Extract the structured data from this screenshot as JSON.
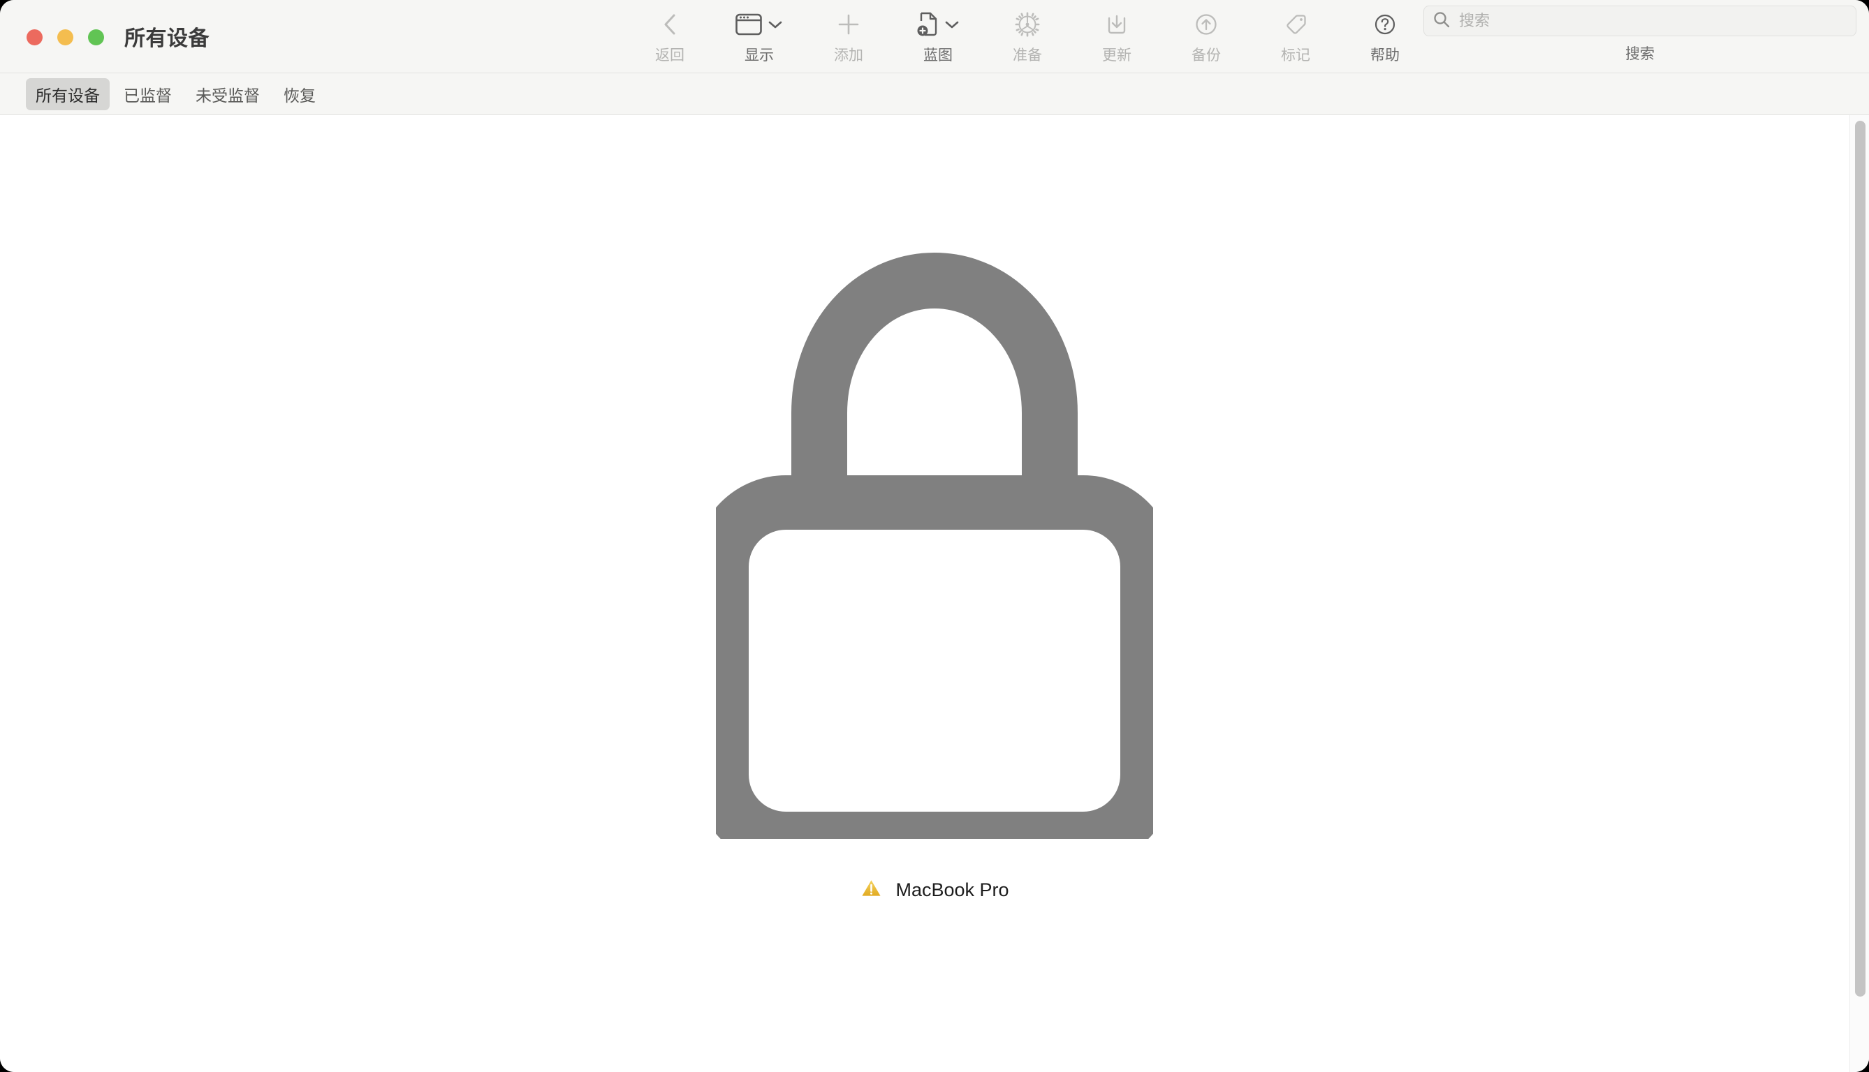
{
  "window": {
    "title": "所有设备",
    "traffic_lights": {
      "close_color": "#ec6a5e",
      "minimize_color": "#f4bd4f",
      "maximize_color": "#61c454"
    }
  },
  "toolbar": {
    "items": [
      {
        "label": "返回",
        "icon": "chevron-left-icon",
        "enabled": false,
        "has_chevron": false
      },
      {
        "label": "显示",
        "icon": "window-icon",
        "enabled": true,
        "has_chevron": true
      },
      {
        "label": "添加",
        "icon": "plus-icon",
        "enabled": false,
        "has_chevron": false
      },
      {
        "label": "蓝图",
        "icon": "blueprint-icon",
        "enabled": true,
        "has_chevron": true
      },
      {
        "label": "准备",
        "icon": "gear-icon",
        "enabled": false,
        "has_chevron": false
      },
      {
        "label": "更新",
        "icon": "download-icon",
        "enabled": false,
        "has_chevron": false
      },
      {
        "label": "备份",
        "icon": "upload-circle-icon",
        "enabled": false,
        "has_chevron": false
      },
      {
        "label": "标记",
        "icon": "tag-icon",
        "enabled": false,
        "has_chevron": false
      },
      {
        "label": "帮助",
        "icon": "question-circle-icon",
        "enabled": true,
        "has_chevron": false
      }
    ]
  },
  "search": {
    "placeholder": "搜索",
    "value": "",
    "caption": "搜索",
    "icon": "search-icon"
  },
  "tabs": [
    {
      "label": "所有设备",
      "selected": true
    },
    {
      "label": "已监督",
      "selected": false
    },
    {
      "label": "未受监督",
      "selected": false
    },
    {
      "label": "恢复",
      "selected": false
    }
  ],
  "content": {
    "device": {
      "name": "MacBook Pro",
      "icon": "lock-icon",
      "icon_color": "#808080",
      "status_icon": "warning-triangle-icon",
      "status_color": "#eec03a"
    }
  },
  "scrollbar": {
    "thumb_color": "#c4c4c4"
  }
}
